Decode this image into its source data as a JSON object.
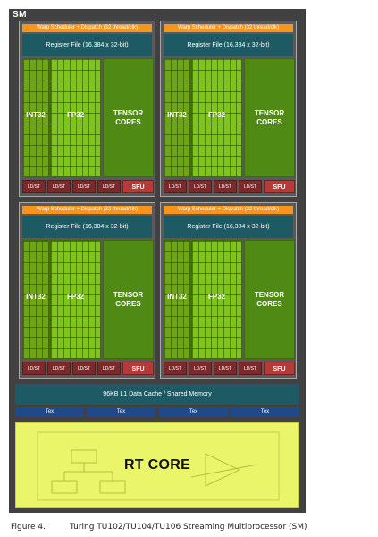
{
  "sm": {
    "label": "SM",
    "quadrants": [
      {
        "warp_scheduler": "Warp Scheduler + Dispatch (32 thread/clk)",
        "register_file": "Register File (16,384 x 32-bit)",
        "int32": "INT32",
        "fp32": "FP32",
        "tensor": "TENSOR\nCORES",
        "ldst": [
          "LD/ST",
          "LD/ST",
          "LD/ST",
          "LD/ST"
        ],
        "sfu": "SFU"
      },
      {
        "warp_scheduler": "Warp Scheduler + Dispatch (32 thread/clk)",
        "register_file": "Register File (16,384 x 32-bit)",
        "int32": "INT32",
        "fp32": "FP32",
        "tensor": "TENSOR\nCORES",
        "ldst": [
          "LD/ST",
          "LD/ST",
          "LD/ST",
          "LD/ST"
        ],
        "sfu": "SFU"
      },
      {
        "warp_scheduler": "Warp Scheduler + Dispatch (32 thread/clk)",
        "register_file": "Register File (16,384 x 32-bit)",
        "int32": "INT32",
        "fp32": "FP32",
        "tensor": "TENSOR\nCORES",
        "ldst": [
          "LD/ST",
          "LD/ST",
          "LD/ST",
          "LD/ST"
        ],
        "sfu": "SFU"
      },
      {
        "warp_scheduler": "Warp Scheduler + Dispatch (32 thread/clk)",
        "register_file": "Register File (16,384 x 32-bit)",
        "int32": "INT32",
        "fp32": "FP32",
        "tensor": "TENSOR\nCORES",
        "ldst": [
          "LD/ST",
          "LD/ST",
          "LD/ST",
          "LD/ST"
        ],
        "sfu": "SFU"
      }
    ],
    "l1_cache": "96KB L1 Data Cache / Shared Memory",
    "tex_units": [
      "Tex",
      "Tex",
      "Tex",
      "Tex"
    ],
    "rt_core": "RT CORE"
  },
  "caption": {
    "figure": "Figure 4.",
    "text": "Turing TU102/TU104/TU106 Streaming Multiprocessor (SM)"
  },
  "colors": {
    "sm_background": "#414141",
    "warp_scheduler": "#f7941d",
    "register_file": "#1e5a63",
    "int32_core": "#6ea516",
    "fp32_core": "#7fc41c",
    "tensor_core": "#4f8a14",
    "ldst": "#7a2a2a",
    "sfu": "#b53a3a",
    "tex": "#1f4a8a",
    "rt_core": "#ebf56a"
  }
}
